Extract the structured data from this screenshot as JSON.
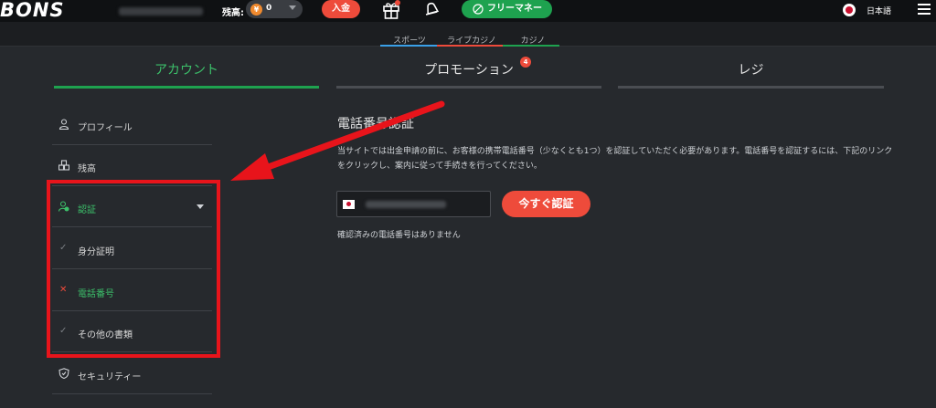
{
  "header": {
    "logo": "BONS",
    "balance_label": "残高:",
    "balance_coin": "¥",
    "balance_value": "0",
    "deposit_label": "入金",
    "free_money_label": "フリーマネー",
    "language": "日本語"
  },
  "subnav": {
    "items": [
      {
        "label": "スポーツ",
        "color": "#3aa0e8"
      },
      {
        "label": "ライブカジノ",
        "color": "#ee4b3b"
      },
      {
        "label": "カジノ",
        "color": "#1ea24f"
      }
    ]
  },
  "tabs": [
    {
      "label": "アカウント",
      "active": true
    },
    {
      "label": "プロモーション",
      "badge": "4"
    },
    {
      "label": "レジ"
    }
  ],
  "sidebar": {
    "items": [
      {
        "label": "プロフィール",
        "icon": "user-icon"
      },
      {
        "label": "残高",
        "icon": "coins-icon"
      },
      {
        "label": "認証",
        "icon": "user-check-icon",
        "active": true
      },
      {
        "label": "身分証明",
        "icon": "check-icon"
      },
      {
        "label": "電話番号",
        "icon": "x-icon",
        "active": true
      },
      {
        "label": "その他の書類",
        "icon": "check-icon"
      },
      {
        "label": "セキュリティー",
        "icon": "shield-icon"
      }
    ]
  },
  "content": {
    "title": "電話番号認証",
    "description": "当サイトでは出金申請の前に、お客様の携帯電話番号（少なくとも1つ）を認証していただく必要があります。電話番号を認証するには、下記のリンクをクリックし、案内に従って手続きを行ってください。",
    "verify_button": "今すぐ認証",
    "no_phone_text": "確認済みの電話番号はありません"
  },
  "colors": {
    "accent_green": "#1ea24f",
    "accent_red": "#ee4b3b",
    "highlight_red": "#e8141b"
  }
}
